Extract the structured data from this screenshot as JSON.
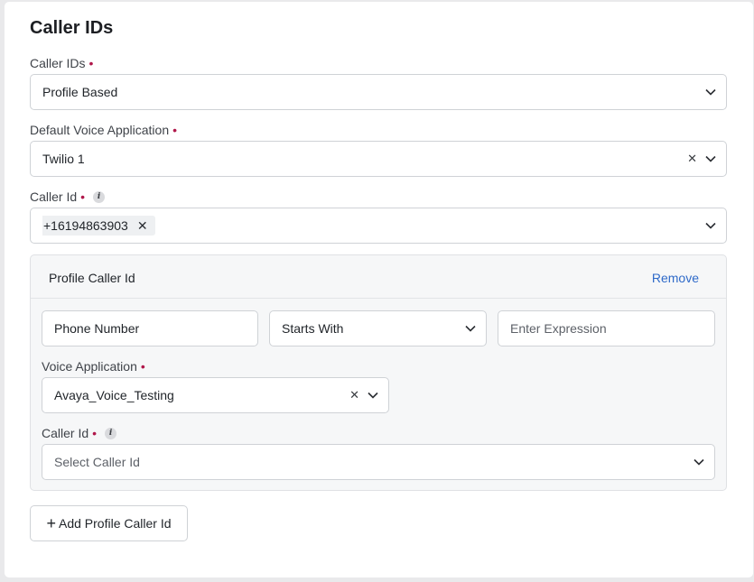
{
  "section": {
    "title": "Caller IDs"
  },
  "caller_ids": {
    "label": "Caller IDs",
    "value": "Profile Based"
  },
  "default_voice_app": {
    "label": "Default Voice Application",
    "value": "Twilio 1"
  },
  "caller_id": {
    "label": "Caller Id",
    "chip": "+16194863903"
  },
  "profile_panel": {
    "title": "Profile Caller Id",
    "remove_label": "Remove",
    "phone_field": {
      "placeholder": "Phone Number"
    },
    "operator": {
      "value": "Starts With"
    },
    "expression": {
      "placeholder": "Enter Expression"
    },
    "voice_app": {
      "label": "Voice Application",
      "value": "Avaya_Voice_Testing"
    },
    "caller_id": {
      "label": "Caller Id",
      "placeholder": "Select Caller Id"
    }
  },
  "add_button": {
    "label": "Add Profile Caller Id"
  },
  "colors": {
    "required": "#b0174a",
    "link": "#2f6ac9",
    "border": "#cfd2d6"
  }
}
